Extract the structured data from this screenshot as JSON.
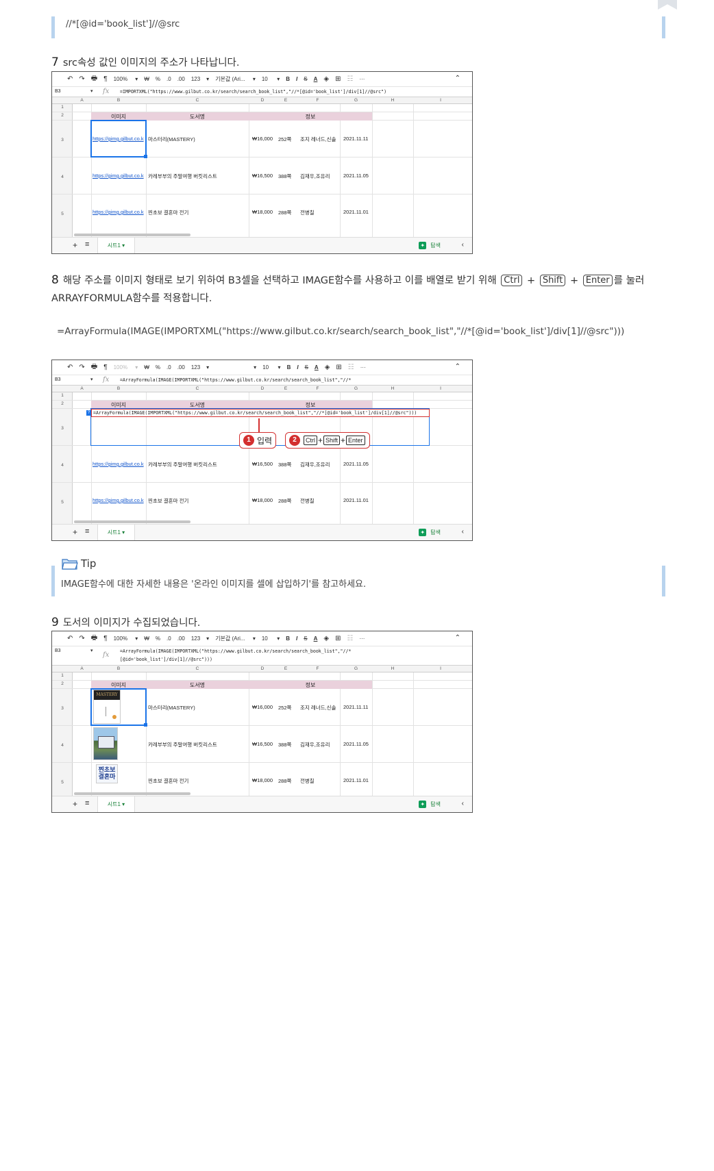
{
  "code_line": "//*[@id='book_list']//@src",
  "step7": {
    "num": "7",
    "text": "src속성 값인 이미지의 주소가 나타납니다."
  },
  "step8": {
    "num": "8",
    "text1": "해당 주소를 이미지 형태로 보기 위하여 B3셀을 선택하고 IMAGE함수를 사용하고 이를 배열로 받기 위해",
    "key_ctrl": "Ctrl",
    "plus1": "+",
    "key_shift": "Shift",
    "plus2": "+",
    "key_enter": "Enter",
    "text2": "를 눌러 ARRAYFORMULA함수를 적용합니다."
  },
  "formula": "=ArrayFormula(IMAGE(IMPORTXML(\"https://www.gilbut.co.kr/search/search_book_list\",\"//*[@id='book_list']/div[1]//@src\")))",
  "tip": {
    "label": "Tip",
    "text": "IMAGE함수에 대한 자세한 내용은 '온라인 이미지를 셀에 삽입하기'를 참고하세요."
  },
  "step9": {
    "num": "9",
    "text": "도서의 이미지가 수집되었습니다."
  },
  "toolbar": {
    "undo": "↶",
    "redo": "↷",
    "print": "🖶",
    "paint": "¶",
    "zoom": "100%",
    "won": "₩",
    "pct": "%",
    "dec0": ".0",
    "dec00": ".00",
    "num": "123",
    "font": "기본값 (Ari...",
    "size": "10",
    "bold": "B",
    "italic": "I",
    "strike": "S",
    "color": "A",
    "more": "···"
  },
  "cell_ref": "B3",
  "columns": [
    "A",
    "B",
    "C",
    "D",
    "E",
    "F",
    "G",
    "H",
    "I"
  ],
  "rows": [
    "1",
    "2",
    "3",
    "4",
    "5"
  ],
  "headers": {
    "image": "이미지",
    "title": "도서명",
    "info": "정보"
  },
  "sheet1": {
    "formula": "=IMPORTXML(\"https://www.gilbut.co.kr/search/search_book_list\",\"//*[@id='book_list']/div[1]//@src\")",
    "rows": [
      {
        "url": "https://gimg.gilbut.co.k",
        "title": "마스터리(MASTERY)",
        "price": "₩16,000",
        "pages": "252쪽",
        "author": "조지 레너드,신솔",
        "date": "2021.11.11"
      },
      {
        "url": "https://gimg.gilbut.co.k",
        "title": "카레부부의 주말여행 버킷리스트",
        "price": "₩16,500",
        "pages": "388쪽",
        "author": "김재우,조유리",
        "date": "2021.11.05"
      },
      {
        "url": "https://gimg.gilbut.co.k",
        "title": "찐초보 결혼마 전기",
        "price": "₩18,000",
        "pages": "288쪽",
        "author": "전병칠",
        "date": "2021.11.01"
      }
    ]
  },
  "sheet2": {
    "formula_bar": "=ArrayFormula(IMAGE(IMPORTXML(\"https://www.gilbut.co.kr/search/search_book_list\",\"//*",
    "edit_text": "=ArrayFormula(IMAGE(IMPORTXML(\"https://www.gilbut.co.kr/search/search_book_list\",\"//*[@id='book_list']/div[1]//@src\")))",
    "callout1": {
      "num": "1",
      "label": "입력"
    },
    "callout2": {
      "num": "2",
      "k1": "Ctrl",
      "p1": "+",
      "k2": "Shift",
      "p2": "+",
      "k3": "Enter"
    }
  },
  "sheet3": {
    "formula_line1": "=ArrayFormula(IMAGE(IMPORTXML(\"https://www.gilbut.co.kr/search/search_book_list\",\"//*",
    "formula_line2": "[@id='book_list']/div[1]//@src\")))",
    "cover1": "MASTERY",
    "cover3": "찐초보\n결혼마"
  },
  "bottom": {
    "add": "+",
    "menu": "≡",
    "tab": "시트1 ▾",
    "explore": "탐색",
    "chev": "‹"
  },
  "colors": {
    "accent_bar": "#b8d3ee",
    "header_band": "#ead1dc",
    "selection": "#1a73e8",
    "callout": "#d32f2f",
    "link": "#1155cc"
  }
}
